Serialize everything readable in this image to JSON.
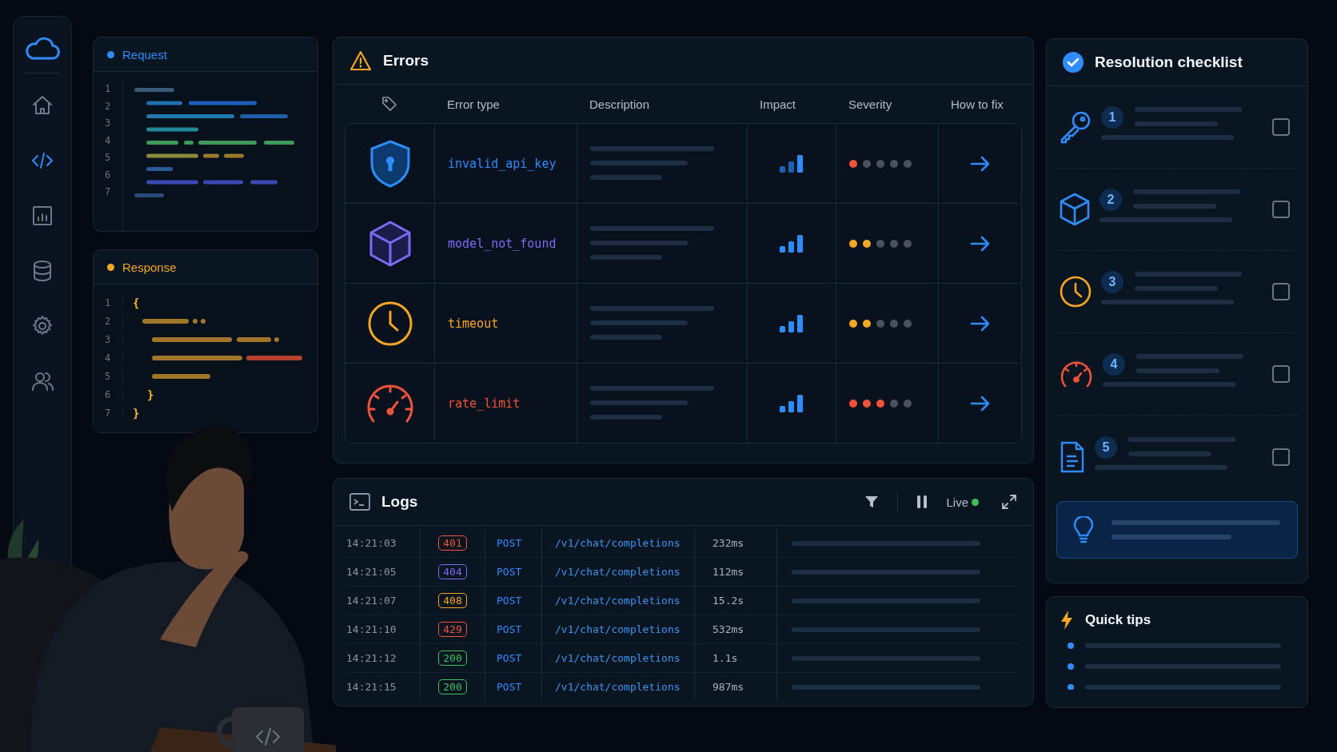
{
  "sidebar": {
    "items": [
      {
        "selected": false
      },
      {
        "selected": true
      },
      {
        "selected": false
      },
      {
        "selected": false
      },
      {
        "selected": false
      },
      {
        "selected": false
      }
    ]
  },
  "request": {
    "title": "Request",
    "line_numbers": [
      "1",
      "2",
      "3",
      "4",
      "5",
      "6",
      "7"
    ]
  },
  "response": {
    "title": "Response",
    "lines": [
      {
        "number": "1",
        "text": "{"
      },
      {
        "number": "2"
      },
      {
        "number": "3"
      },
      {
        "number": "4"
      },
      {
        "number": "5"
      },
      {
        "number": "6",
        "text": "}"
      },
      {
        "number": "7",
        "text": "}"
      }
    ]
  },
  "errors": {
    "title": "Errors",
    "columns": [
      "Error type",
      "Description",
      "Impact",
      "Severity",
      "How to fix"
    ],
    "rows": [
      {
        "name": "invalid_api_key",
        "color": "#2e8cff",
        "stars": 1
      },
      {
        "name": "model_not_found",
        "color": "#7b6cf6",
        "stars": 2
      },
      {
        "name": "timeout",
        "color": "#f5a623",
        "stars": 2
      },
      {
        "name": "rate_limit",
        "color": "#f0533a",
        "stars": 3
      }
    ]
  },
  "logs": {
    "title": "Logs",
    "live": "Live",
    "rows": [
      {
        "time": "14:21:03",
        "code": "401",
        "color": "#f0533a",
        "method": "POST",
        "path": "/v1/chat/completions",
        "duration": "232ms"
      },
      {
        "time": "14:21:05",
        "code": "404",
        "color": "#7b6cf6",
        "method": "POST",
        "path": "/v1/chat/completions",
        "duration": "112ms"
      },
      {
        "time": "14:21:07",
        "code": "408",
        "color": "#f5a623",
        "method": "POST",
        "path": "/v1/chat/completions",
        "duration": "15.2s"
      },
      {
        "time": "14:21:10",
        "code": "429",
        "color": "#f0533a",
        "method": "POST",
        "path": "/v1/chat/completions",
        "duration": "532ms"
      },
      {
        "time": "14:21:12",
        "code": "200",
        "color": "#3fbf5a",
        "method": "POST",
        "path": "/v1/chat/completions",
        "duration": "1.1s"
      },
      {
        "time": "14:21:15",
        "code": "200",
        "color": "#3fbf5a",
        "method": "POST",
        "path": "/v1/chat/completions",
        "duration": "987ms"
      }
    ]
  },
  "checklist": {
    "title": "Resolution checklist",
    "items": [
      {
        "number": "1",
        "checked": false
      },
      {
        "number": "2",
        "checked": false
      },
      {
        "number": "3",
        "checked": false
      },
      {
        "number": "4",
        "checked": false
      },
      {
        "number": "5",
        "checked": false
      }
    ]
  },
  "quick_tips": {
    "title": "Quick tips"
  }
}
